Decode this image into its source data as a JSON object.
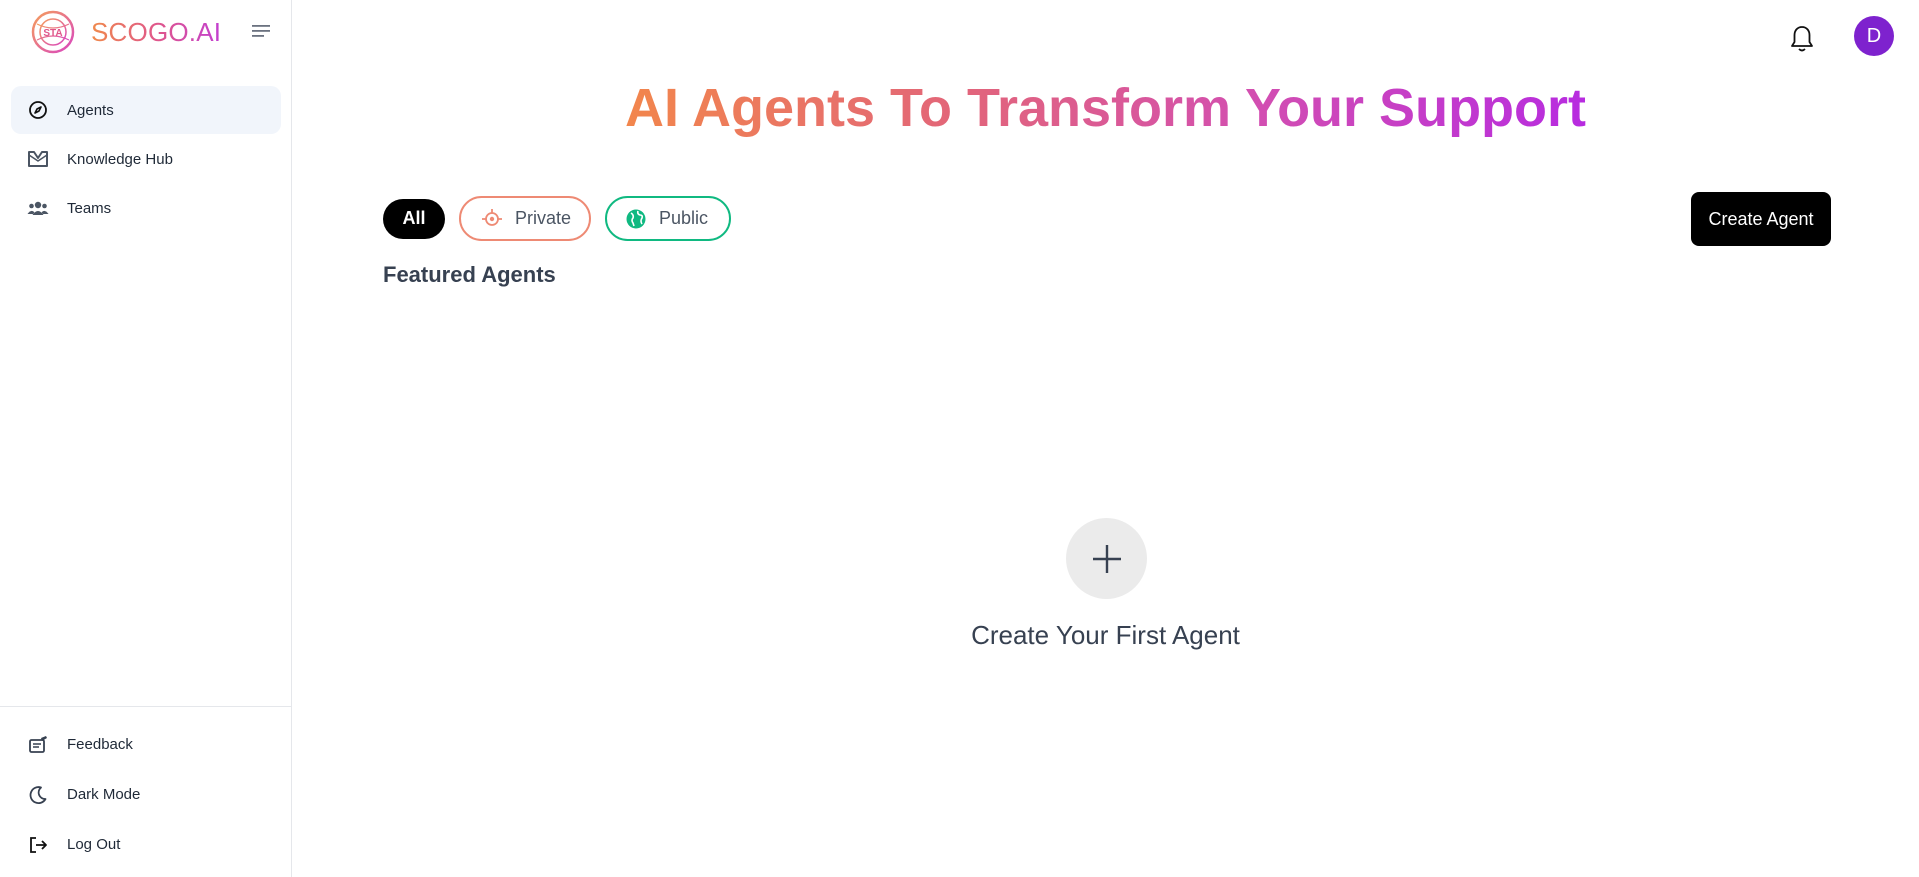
{
  "brand": {
    "name": "SCOGO.AI",
    "logo_text": "STA"
  },
  "sidebar": {
    "items": [
      {
        "label": "Agents",
        "icon": "compass-icon",
        "active": true
      },
      {
        "label": "Knowledge Hub",
        "icon": "book-icon",
        "active": false
      },
      {
        "label": "Teams",
        "icon": "users-icon",
        "active": false
      }
    ],
    "bottom_items": [
      {
        "label": "Feedback",
        "icon": "feedback-icon"
      },
      {
        "label": "Dark Mode",
        "icon": "moon-icon"
      },
      {
        "label": "Log Out",
        "icon": "logout-icon"
      }
    ]
  },
  "header": {
    "avatar_initial": "D"
  },
  "hero": {
    "title": "AI Agents To Transform Your Support"
  },
  "filters": {
    "all": "All",
    "private": "Private",
    "public": "Public"
  },
  "actions": {
    "create_agent": "Create Agent"
  },
  "section": {
    "featured_title": "Featured Agents"
  },
  "empty_state": {
    "label": "Create Your First Agent"
  },
  "colors": {
    "accent_start": "#f2864c",
    "accent_end": "#b72be0",
    "private_border": "#ee8a74",
    "public_border": "#10b981",
    "avatar_bg": "#7e22ce"
  }
}
